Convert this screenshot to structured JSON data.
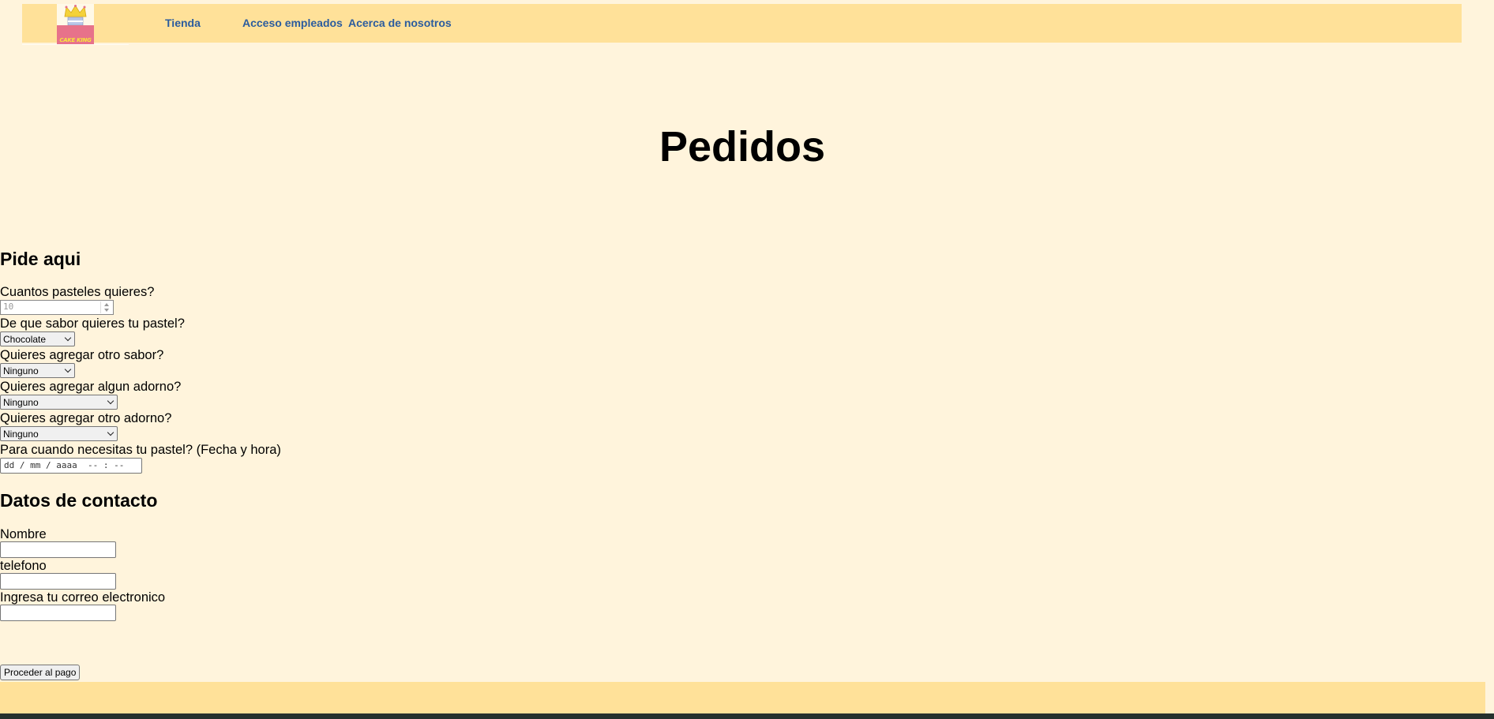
{
  "header": {
    "brand": "CAKE KING",
    "nav": [
      "Tienda",
      "Acceso empleados",
      "Acerca de nosotros"
    ]
  },
  "page_title": "Pedidos",
  "order": {
    "heading": "Pide aqui",
    "qty_label": "Cuantos pasteles quieres?",
    "qty_placeholder": "10",
    "flavor_label": "De que sabor quieres tu pastel?",
    "flavor_value": "Chocolate",
    "flavor2_label": "Quieres agregar otro sabor?",
    "flavor2_value": "Ninguno",
    "decor_label": "Quieres agregar algun adorno?",
    "decor_value": "Ninguno",
    "decor2_label": "Quieres agregar otro adorno?",
    "decor2_value": "Ninguno",
    "date_label": "Para cuando necesitas tu pastel? (Fecha y hora)",
    "date_placeholder": "dd / mm / aaaa  -- : --"
  },
  "contact": {
    "heading": "Datos de contacto",
    "name_label": "Nombre",
    "phone_label": "telefono",
    "email_label": "Ingresa tu correo electronico"
  },
  "submit_label": "Proceder al pago",
  "colors": {
    "background": "#FFF4DC",
    "header_bar": "#FFE199",
    "nav_link": "#2B5C9E",
    "footer_bottom": "#26312E"
  }
}
